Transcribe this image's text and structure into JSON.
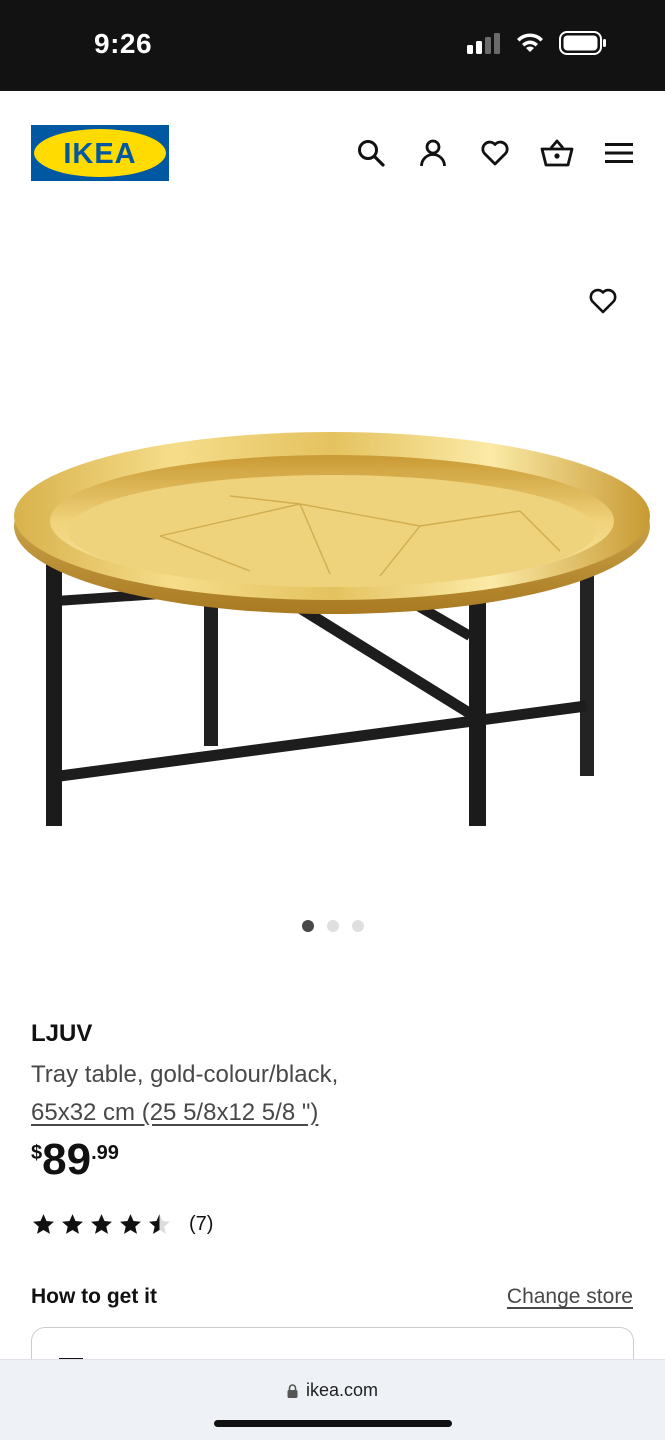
{
  "status_bar": {
    "time": "9:26"
  },
  "header": {
    "logo_text": "IKEA",
    "brand_colors": {
      "blue": "#0058A3",
      "yellow": "#FFDB00"
    },
    "icons": [
      "search-icon",
      "account-icon",
      "wishlist-icon",
      "basket-icon",
      "menu-icon"
    ]
  },
  "gallery": {
    "image_count": 3,
    "active_index": 0,
    "favourite_icon": "heart-icon"
  },
  "product": {
    "name": "LJUV",
    "description": "Tray table, gold-colour/black,",
    "size": "65x32 cm (25 5/8x12 5/8 \")",
    "price_currency": "$",
    "price_integer": "89",
    "price_decimal": ".99",
    "rating": 4.5,
    "review_count": "(7)"
  },
  "availability": {
    "title": "How to get it",
    "change_store_label": "Change store"
  },
  "browser": {
    "url": "ikea.com"
  }
}
